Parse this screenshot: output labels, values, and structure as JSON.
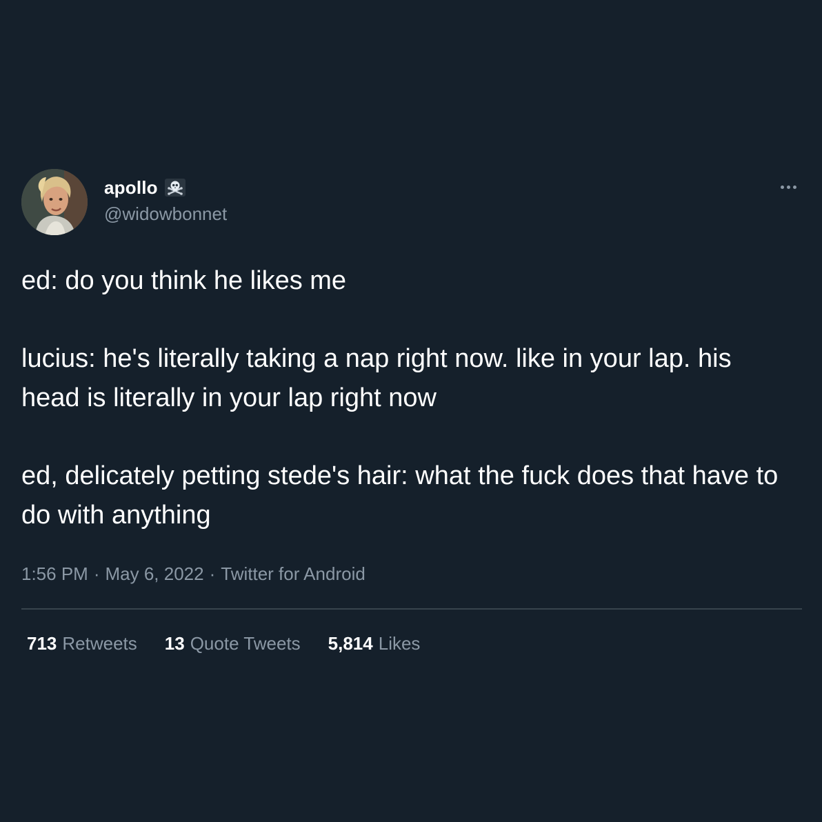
{
  "user": {
    "display_name": "apollo",
    "handle": "@widowbonnet",
    "badge_icon": "skull-crossbones-icon"
  },
  "tweet": {
    "lines": [
      "ed: do you think he likes me",
      "lucius: he's literally taking a nap right now. like in your lap. his head is literally in your lap right now",
      "ed, delicately petting stede's hair: what the fuck does that have to do with anything"
    ]
  },
  "meta": {
    "time": "1:56 PM",
    "separator": "·",
    "date": "May 6, 2022",
    "source": "Twitter for Android"
  },
  "stats": {
    "retweets_count": "713",
    "retweets_label": "Retweets",
    "quotes_count": "13",
    "quotes_label": "Quote Tweets",
    "likes_count": "5,814",
    "likes_label": "Likes"
  },
  "colors": {
    "background": "#15202b",
    "primary_text": "#ffffff",
    "secondary_text": "#8b98a5",
    "divider": "#38444d"
  }
}
